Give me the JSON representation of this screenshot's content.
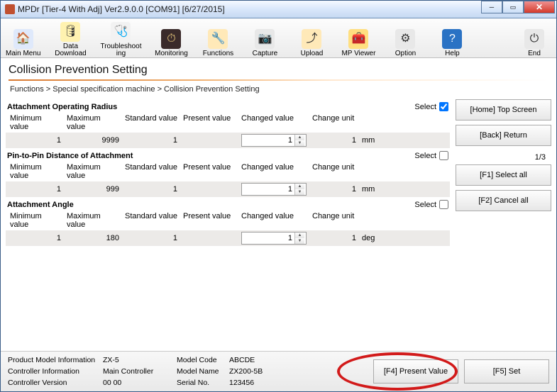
{
  "window": {
    "title": "MPDr [Tier-4 With Adj] Ver2.9.0.0 [COM91] [6/27/2015]"
  },
  "toolbar": [
    {
      "label": "Main Menu",
      "icon": "🏠",
      "bg": "#dfe9fb"
    },
    {
      "label": "Data\nDownload",
      "icon": "🛢",
      "bg": "#fff2b0",
      "arrow": true
    },
    {
      "label": "Troubleshoot\ning",
      "icon": "🩺",
      "bg": "#f2f2f2"
    },
    {
      "label": "Monitoring",
      "icon": "⏱",
      "bg": "#3a2a2a",
      "fg": "#f0d080"
    },
    {
      "label": "Functions",
      "icon": "🔧",
      "bg": "#ffe9b8"
    },
    {
      "label": "Capture",
      "icon": "📷",
      "bg": "#e8e8e8"
    },
    {
      "label": "Upload",
      "icon": "⤴",
      "bg": "#ffe9b8"
    },
    {
      "label": "MP Viewer",
      "icon": "🧰",
      "bg": "#ffdf80"
    },
    {
      "label": "Option",
      "icon": "⚙",
      "bg": "#e8e8e8"
    },
    {
      "label": "Help",
      "icon": "?",
      "bg": "#2a72c4",
      "fg": "#fff"
    },
    {
      "label": "End",
      "icon": "⏻",
      "bg": "#e8e8e8",
      "push": true
    }
  ],
  "page": {
    "title": "Collision Prevention Setting",
    "breadcrumb": "Functions   >   Special specification machine   >   Collision Prevention Setting",
    "page_count": "1/3"
  },
  "columns": {
    "min": "Minimum value",
    "max": "Maximum value",
    "std": "Standard value",
    "pres": "Present value",
    "chg": "Changed value",
    "cu": "Change unit"
  },
  "sections": [
    {
      "title": "Attachment Operating Radius",
      "select_label": "Select",
      "checked": true,
      "min": "1",
      "max": "9999",
      "std": "1",
      "pres": "",
      "chg": "1",
      "cu": "1",
      "unit": "mm"
    },
    {
      "title": "Pin-to-Pin Distance of Attachment",
      "select_label": "Select",
      "checked": false,
      "min": "1",
      "max": "999",
      "std": "1",
      "pres": "",
      "chg": "1",
      "cu": "1",
      "unit": "mm"
    },
    {
      "title": "Attachment Angle",
      "select_label": "Select",
      "checked": false,
      "min": "1",
      "max": "180",
      "std": "1",
      "pres": "",
      "chg": "1",
      "cu": "1",
      "unit": "deg"
    }
  ],
  "right_buttons": {
    "home": "[Home] Top Screen",
    "back": "[Back] Return",
    "f1": "[F1] Select all",
    "f2": "[F2] Cancel all"
  },
  "footer": {
    "labels": {
      "pmi": "Product Model Information",
      "ci": "Controller Information",
      "cv": "Controller Version",
      "mc": "Model Code",
      "mn": "Model Name",
      "sn": "Serial No."
    },
    "values": {
      "pmi": "ZX-5",
      "ci": "Main Controller",
      "cv": "00 00",
      "mc": "ABCDE",
      "mn": "ZX200-5B",
      "sn": "123456"
    },
    "f4": "[F4] Present Value",
    "f5": "[F5] Set"
  }
}
